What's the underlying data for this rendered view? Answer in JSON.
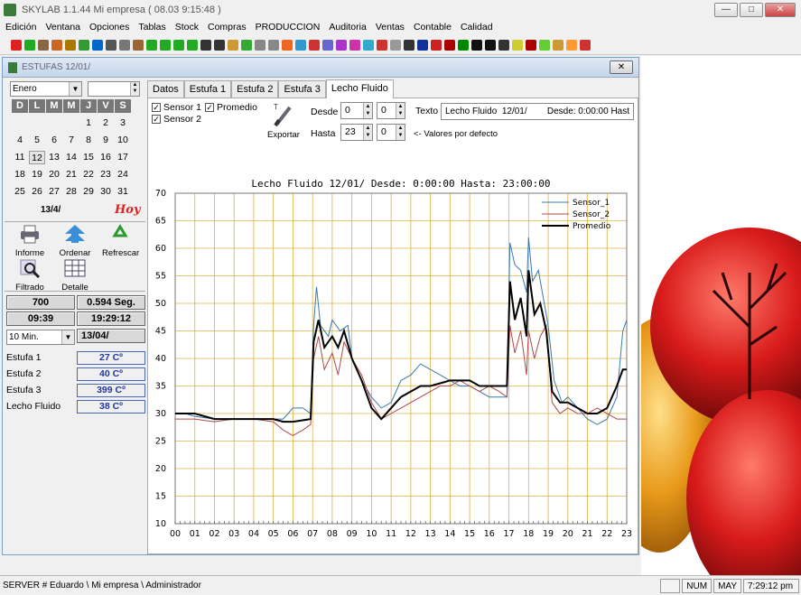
{
  "app": {
    "title": "SKYLAB 1.1.44  Mi empresa  ( 08.03      9:15:48 )",
    "window_buttons": [
      "—",
      "□",
      "✕"
    ]
  },
  "menu": [
    "Edición",
    "Ventana",
    "Opciones",
    "Tablas",
    "Stock",
    "Compras",
    "PRODUCCION",
    "Auditoria",
    "Ventas",
    "Contable",
    "Calidad"
  ],
  "toolbar_colors": [
    "#d22",
    "#2a2",
    "#864",
    "#c62",
    "#a70",
    "#393",
    "#06c",
    "#555",
    "#777",
    "#963",
    "#2a2",
    "#2a2",
    "#2a2",
    "#2a2",
    "#333",
    "#333",
    "#c93",
    "#3a3",
    "#888",
    "#888",
    "#e62",
    "#39c",
    "#c33",
    "#66c",
    "#a3c",
    "#c3a",
    "#3ac",
    "#c33",
    "#999",
    "#333",
    "#139",
    "#c22",
    "#a00",
    "#080",
    "#111",
    "#111",
    "#333",
    "#cc3",
    "#a00",
    "#6c3",
    "#c93",
    "#f93",
    "#c33"
  ],
  "child": {
    "title": "ESTUFAS 12/01/",
    "close": "✕"
  },
  "left": {
    "month": "Enero",
    "year": "",
    "cal_head": [
      "D",
      "L",
      "M",
      "M",
      "J",
      "V",
      "S"
    ],
    "cal_rows": [
      [
        "",
        "",
        "",
        "",
        "1",
        "2",
        "3"
      ],
      [
        "4",
        "5",
        "6",
        "7",
        "8",
        "9",
        "10"
      ],
      [
        "11",
        "12",
        "13",
        "14",
        "15",
        "16",
        "17"
      ],
      [
        "18",
        "19",
        "20",
        "21",
        "22",
        "23",
        "24"
      ],
      [
        "25",
        "26",
        "27",
        "28",
        "29",
        "30",
        "31"
      ]
    ],
    "today": "13/4/",
    "hoy": "Hoy",
    "buttons": {
      "informe": "Informe",
      "ordenar": "Ordenar",
      "refrescar": "Refrescar",
      "filtrado": "Filtrado",
      "detalle": "Detalle"
    },
    "box1": "700",
    "box2": "0.594 Seg.",
    "box3": "09:39",
    "box4": "19:29:12",
    "interval": "10 Min.",
    "date2": "13/04/",
    "readings": [
      {
        "label": "Estufa 1",
        "value": "27 Cº"
      },
      {
        "label": "Estufa 2",
        "value": "40 Cº"
      },
      {
        "label": "Estufa 3",
        "value": "399 Cº"
      },
      {
        "label": "Lecho Fluido",
        "value": "38 Cº"
      }
    ]
  },
  "tabs": [
    "Datos",
    "Estufa 1",
    "Estufa 2",
    "Estufa 3",
    "Lecho Fluido"
  ],
  "controls": {
    "sensor1": "Sensor 1",
    "sensor2": "Sensor 2",
    "promedio": "Promedio",
    "exportar": "Exportar",
    "desde": "Desde",
    "hasta": "Hasta",
    "desde_h": "0",
    "desde_m": "0",
    "hasta_h": "23",
    "hasta_m": "0",
    "texto": "Texto",
    "texto_val": "Lecho Fluido  12/01/        Desde: 0:00:00 Hast",
    "defaults": "<- Valores por defecto"
  },
  "statusbar": {
    "main": "SERVER # Eduardo \\ Mi empresa \\ Administrador",
    "num": "NUM",
    "may": "MAY",
    "time": "7:29:12 pm"
  },
  "chart_data": {
    "type": "line",
    "title": "Lecho Fluido  12/01/      Desde: 0:00:00 Hasta: 23:00:00",
    "ylim": [
      10,
      70
    ],
    "yticks": [
      10,
      15,
      20,
      25,
      30,
      35,
      40,
      45,
      50,
      55,
      60,
      65,
      70
    ],
    "xlim": [
      0,
      23
    ],
    "xticks": [
      "00",
      "01",
      "02",
      "03",
      "04",
      "05",
      "06",
      "07",
      "08",
      "09",
      "10",
      "11",
      "12",
      "13",
      "14",
      "15",
      "16",
      "17",
      "18",
      "19",
      "20",
      "21",
      "22",
      "23"
    ],
    "grid": true,
    "legend": "top-right",
    "series": [
      {
        "name": "Sensor_1",
        "color": "#3a7ab0",
        "points": [
          [
            0,
            30
          ],
          [
            0.5,
            30
          ],
          [
            1,
            29.5
          ],
          [
            2,
            29
          ],
          [
            3,
            29
          ],
          [
            4,
            29
          ],
          [
            5,
            29
          ],
          [
            5.5,
            29
          ],
          [
            6,
            31
          ],
          [
            6.5,
            31
          ],
          [
            6.9,
            30
          ],
          [
            7.05,
            46
          ],
          [
            7.2,
            53
          ],
          [
            7.4,
            46
          ],
          [
            7.8,
            44
          ],
          [
            8,
            47
          ],
          [
            8.4,
            45
          ],
          [
            8.8,
            46
          ],
          [
            9,
            40
          ],
          [
            9.5,
            36
          ],
          [
            10,
            33
          ],
          [
            10.5,
            31
          ],
          [
            11,
            32
          ],
          [
            11.5,
            36
          ],
          [
            12,
            37
          ],
          [
            12.5,
            39
          ],
          [
            13,
            38
          ],
          [
            13.5,
            37
          ],
          [
            14,
            36
          ],
          [
            14.5,
            35
          ],
          [
            15,
            35
          ],
          [
            15.5,
            34
          ],
          [
            16,
            33
          ],
          [
            16.5,
            33
          ],
          [
            16.9,
            33
          ],
          [
            17.05,
            61
          ],
          [
            17.3,
            57
          ],
          [
            17.6,
            56
          ],
          [
            17.9,
            52
          ],
          [
            18,
            62
          ],
          [
            18.2,
            54
          ],
          [
            18.5,
            56
          ],
          [
            18.8,
            50
          ],
          [
            19,
            46
          ],
          [
            19.3,
            36
          ],
          [
            19.7,
            32
          ],
          [
            20,
            33
          ],
          [
            20.5,
            31
          ],
          [
            21,
            29
          ],
          [
            21.5,
            28
          ],
          [
            22,
            29
          ],
          [
            22.5,
            33
          ],
          [
            22.8,
            45
          ],
          [
            23,
            47
          ]
        ]
      },
      {
        "name": "Sensor_2",
        "color": "#b04848",
        "points": [
          [
            0,
            29
          ],
          [
            1,
            29
          ],
          [
            2,
            28.5
          ],
          [
            3,
            29
          ],
          [
            4,
            29
          ],
          [
            5,
            28.5
          ],
          [
            5.5,
            27
          ],
          [
            6,
            26
          ],
          [
            6.5,
            27
          ],
          [
            6.9,
            28
          ],
          [
            7.05,
            40
          ],
          [
            7.3,
            44
          ],
          [
            7.6,
            38
          ],
          [
            8,
            41
          ],
          [
            8.3,
            37
          ],
          [
            8.6,
            43
          ],
          [
            9,
            40
          ],
          [
            9.5,
            37
          ],
          [
            10,
            32
          ],
          [
            10.5,
            29
          ],
          [
            11,
            30
          ],
          [
            11.5,
            31
          ],
          [
            12,
            32
          ],
          [
            12.5,
            33
          ],
          [
            13,
            34
          ],
          [
            13.5,
            35
          ],
          [
            14,
            35
          ],
          [
            14.5,
            36
          ],
          [
            15,
            35
          ],
          [
            15.5,
            34
          ],
          [
            16,
            35
          ],
          [
            16.5,
            34
          ],
          [
            16.9,
            33
          ],
          [
            17.05,
            46
          ],
          [
            17.3,
            41
          ],
          [
            17.6,
            45
          ],
          [
            17.9,
            37
          ],
          [
            18,
            45
          ],
          [
            18.3,
            40
          ],
          [
            18.6,
            44
          ],
          [
            18.9,
            46
          ],
          [
            19.2,
            32
          ],
          [
            19.6,
            30
          ],
          [
            20,
            31
          ],
          [
            20.5,
            30
          ],
          [
            21,
            30
          ],
          [
            21.5,
            31
          ],
          [
            22,
            30
          ],
          [
            22.5,
            29
          ],
          [
            23,
            29
          ]
        ]
      },
      {
        "name": "Promedio",
        "color": "#000000",
        "points": [
          [
            0,
            30
          ],
          [
            1,
            30
          ],
          [
            2,
            29
          ],
          [
            3,
            29
          ],
          [
            4,
            29
          ],
          [
            5,
            29
          ],
          [
            5.5,
            28.5
          ],
          [
            6,
            28.5
          ],
          [
            6.9,
            29
          ],
          [
            7.05,
            43
          ],
          [
            7.3,
            47
          ],
          [
            7.6,
            42
          ],
          [
            8,
            44
          ],
          [
            8.3,
            42
          ],
          [
            8.6,
            45
          ],
          [
            9,
            40
          ],
          [
            9.5,
            36
          ],
          [
            10,
            31
          ],
          [
            10.5,
            29
          ],
          [
            11,
            31
          ],
          [
            11.5,
            33
          ],
          [
            12,
            34
          ],
          [
            12.5,
            35
          ],
          [
            13,
            35
          ],
          [
            13.5,
            35.5
          ],
          [
            14,
            36
          ],
          [
            14.5,
            36
          ],
          [
            15,
            36
          ],
          [
            15.5,
            35
          ],
          [
            16,
            35
          ],
          [
            16.5,
            35
          ],
          [
            16.9,
            35
          ],
          [
            17.05,
            54
          ],
          [
            17.3,
            47
          ],
          [
            17.6,
            51
          ],
          [
            17.9,
            44
          ],
          [
            18,
            56
          ],
          [
            18.3,
            48
          ],
          [
            18.6,
            50
          ],
          [
            18.9,
            45
          ],
          [
            19.2,
            34
          ],
          [
            19.6,
            32
          ],
          [
            20,
            32
          ],
          [
            20.5,
            31
          ],
          [
            21,
            30
          ],
          [
            21.5,
            30
          ],
          [
            22,
            31
          ],
          [
            22.5,
            35
          ],
          [
            22.8,
            38
          ],
          [
            23,
            38
          ]
        ]
      }
    ]
  }
}
